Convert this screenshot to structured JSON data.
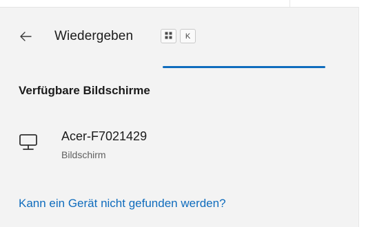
{
  "header": {
    "title": "Wiedergeben",
    "shortcut": {
      "win_key": "win-key-icon",
      "key": "K"
    }
  },
  "progress": {
    "state": "indeterminate",
    "color": "#0f6cbd"
  },
  "section": {
    "title": "Verfügbare Bildschirme"
  },
  "devices": [
    {
      "name": "Acer-F7021429",
      "type": "Bildschirm",
      "icon": "monitor-icon"
    }
  ],
  "footer": {
    "help_link": "Kann ein Gerät nicht gefunden werden?"
  },
  "colors": {
    "accent": "#0f6cbd",
    "panel": "#f3f3f3",
    "text": "#1b1b1b"
  }
}
